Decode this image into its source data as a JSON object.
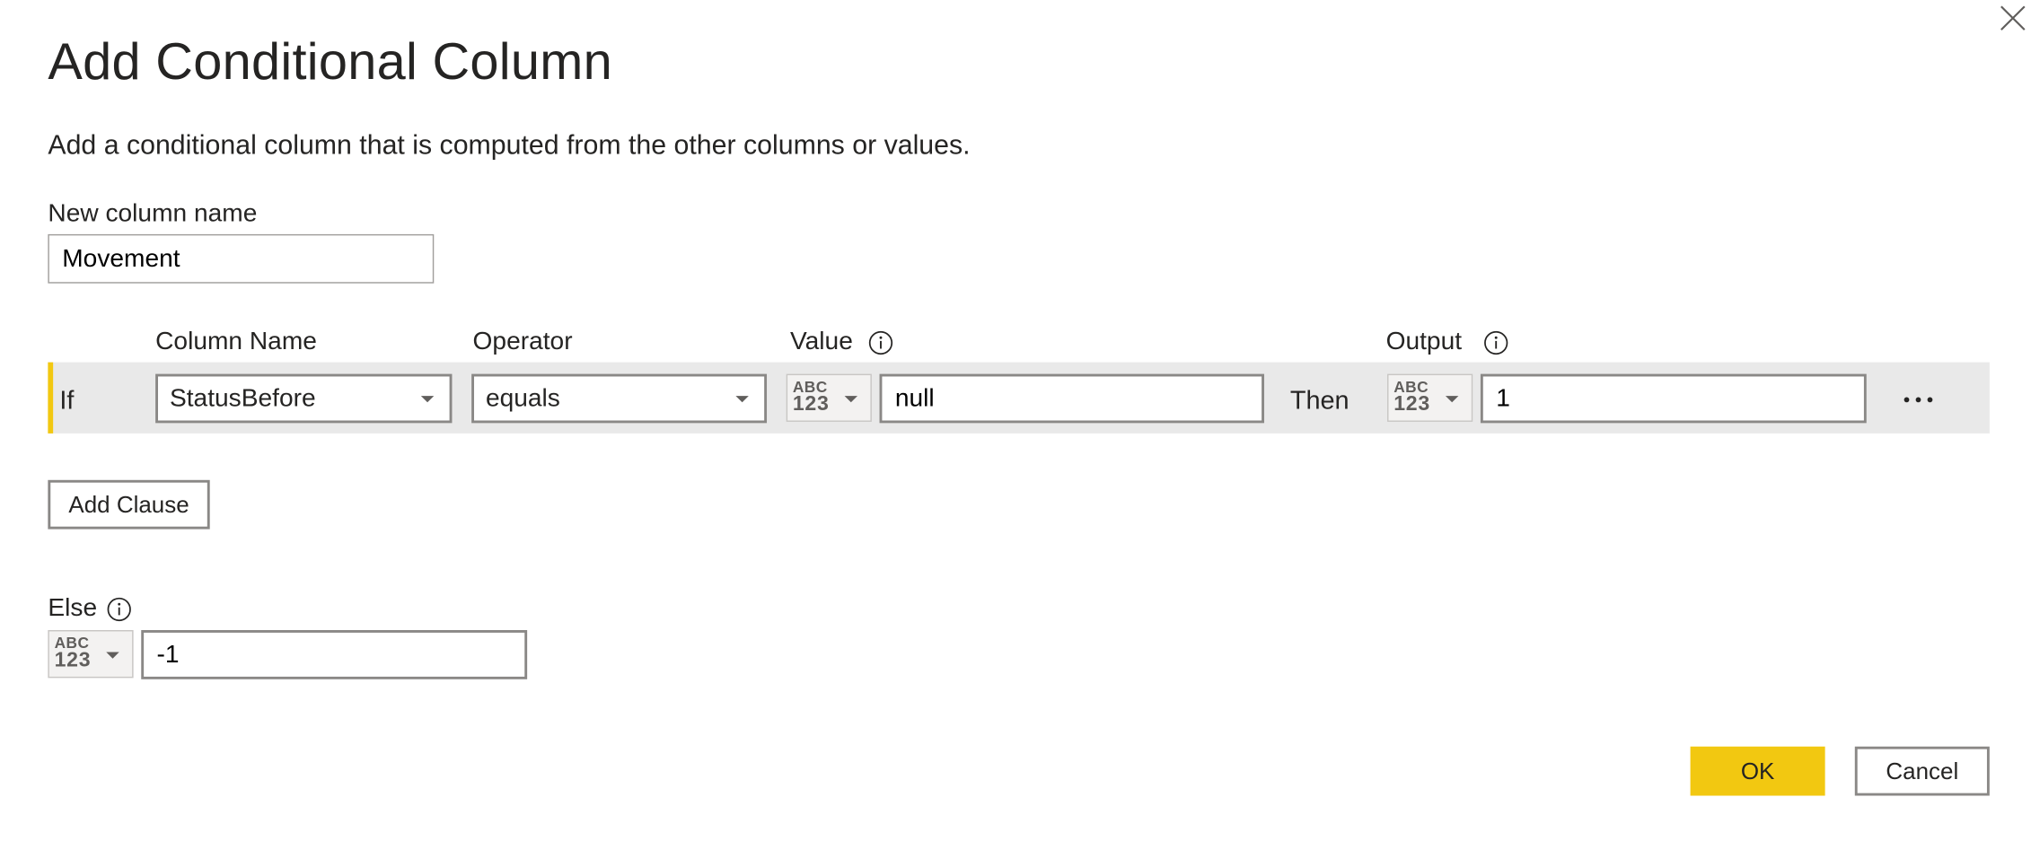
{
  "dialog": {
    "title": "Add Conditional Column",
    "subtitle": "Add a conditional column that is computed from the other columns or values.",
    "close_icon": "close-icon"
  },
  "new_column": {
    "label": "New column name",
    "value": "Movement"
  },
  "headers": {
    "column_name": "Column Name",
    "operator": "Operator",
    "value": "Value",
    "output": "Output"
  },
  "clauses": [
    {
      "if_label": "If",
      "column_name": "StatusBefore",
      "operator": "equals",
      "value_type_icon": "abc-123-type-icon",
      "value_type_abc": "ABC",
      "value_type_num": "123",
      "value": "null",
      "then_label": "Then",
      "output_type_abc": "ABC",
      "output_type_num": "123",
      "output": "1"
    }
  ],
  "add_clause_label": "Add Clause",
  "else": {
    "label": "Else",
    "type_abc": "ABC",
    "type_num": "123",
    "value": "-1"
  },
  "buttons": {
    "ok": "OK",
    "cancel": "Cancel"
  },
  "colors": {
    "accent": "#f2c811",
    "row_background": "#e9e9e9",
    "text": "#252423"
  }
}
